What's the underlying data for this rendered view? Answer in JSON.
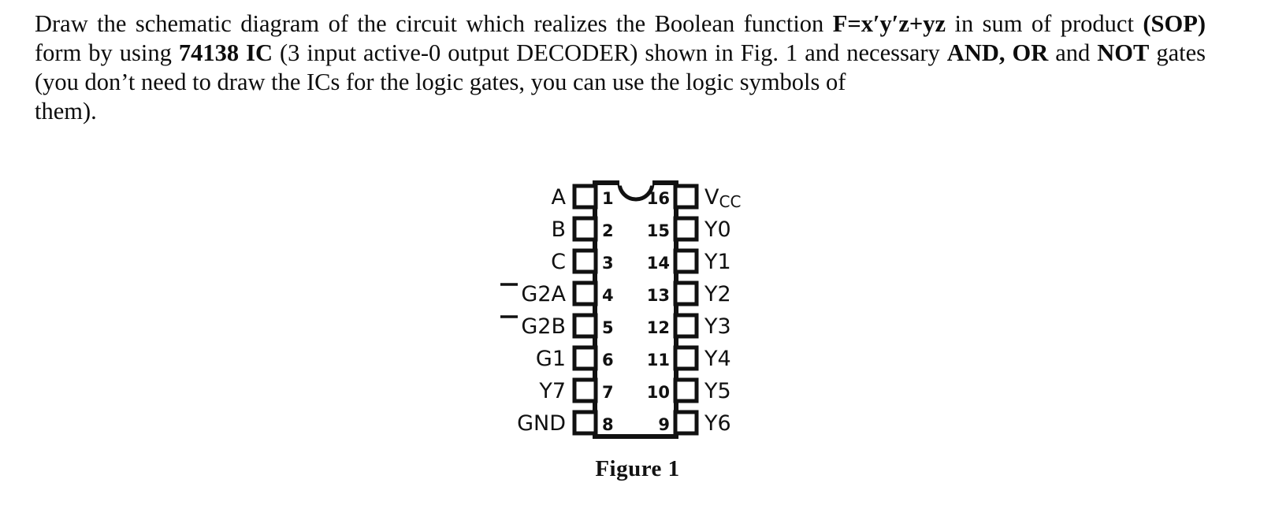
{
  "question": {
    "line1_a": "Draw the schematic diagram of the circuit which realizes the Boolean function ",
    "formula": "F=x′y′z+yz",
    "line1_b": " in sum of product ",
    "sop": "(SOP)",
    "line2_a": " form by using ",
    "ic_name": "74138 IC",
    "line2_b": " (3 input active-0 output DECODER",
    "line2_c": ") shown in Fig. 1 and necessary ",
    "and": "AND,",
    "or": "OR",
    "line3_a": " and ",
    "not": "NOT",
    "line3_b": " gates (you don’t need to draw the ICs for the logic gates, you can use the logic symbols of",
    "line4": "them)."
  },
  "figure": {
    "caption": "Figure 1",
    "chip": {
      "notch": "notch-semicircle",
      "left_pins": [
        {
          "number": "1",
          "label": "A",
          "overline": false
        },
        {
          "number": "2",
          "label": "B",
          "overline": false
        },
        {
          "number": "3",
          "label": "C",
          "overline": false
        },
        {
          "number": "4",
          "label": "G2A",
          "overline": true
        },
        {
          "number": "5",
          "label": "G2B",
          "overline": true
        },
        {
          "number": "6",
          "label": "G1",
          "overline": false
        },
        {
          "number": "7",
          "label": "Y7",
          "overline": false
        },
        {
          "number": "8",
          "label": "GND",
          "overline": false
        }
      ],
      "right_pins": [
        {
          "number": "16",
          "label": "VCC",
          "label_main": "V",
          "label_sub": "CC",
          "overline": false
        },
        {
          "number": "15",
          "label": "Y0",
          "overline": false
        },
        {
          "number": "14",
          "label": "Y1",
          "overline": false
        },
        {
          "number": "13",
          "label": "Y2",
          "overline": false
        },
        {
          "number": "12",
          "label": "Y3",
          "overline": false
        },
        {
          "number": "11",
          "label": "Y4",
          "overline": false
        },
        {
          "number": "10",
          "label": "Y5",
          "overline": false
        },
        {
          "number": "9",
          "label": "Y6",
          "overline": false
        }
      ]
    }
  },
  "colors": {
    "text": "#0d0d0d",
    "ink": "#111111",
    "background": "#ffffff"
  }
}
